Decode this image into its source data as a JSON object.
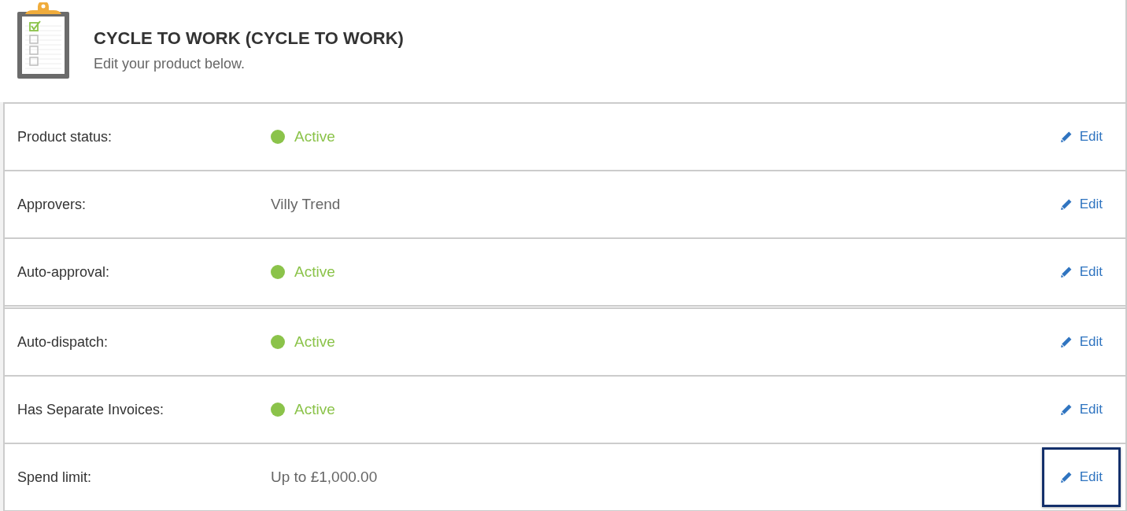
{
  "header": {
    "title": "CYCLE TO WORK (CYCLE TO WORK)",
    "subtitle": "Edit your product below."
  },
  "sections": [
    {
      "rows": [
        {
          "label": "Product status:",
          "value": {
            "kind": "status",
            "text": "Active"
          },
          "edit": {
            "label": "Edit",
            "focused": false
          }
        },
        {
          "label": "Approvers:",
          "value": {
            "kind": "text",
            "text": "Villy Trend"
          },
          "edit": {
            "label": "Edit",
            "focused": false
          }
        },
        {
          "label": "Auto-approval:",
          "value": {
            "kind": "status",
            "text": "Active"
          },
          "edit": {
            "label": "Edit",
            "focused": false
          }
        }
      ]
    },
    {
      "rows": [
        {
          "label": "Auto-dispatch:",
          "value": {
            "kind": "status",
            "text": "Active"
          },
          "edit": {
            "label": "Edit",
            "focused": false
          }
        },
        {
          "label": "Has Separate Invoices:",
          "value": {
            "kind": "status",
            "text": "Active"
          },
          "edit": {
            "label": "Edit",
            "focused": false
          }
        },
        {
          "label": "Spend limit:",
          "value": {
            "kind": "text",
            "text": "Up to £1,000.00"
          },
          "edit": {
            "label": "Edit",
            "focused": true
          }
        }
      ]
    }
  ]
}
